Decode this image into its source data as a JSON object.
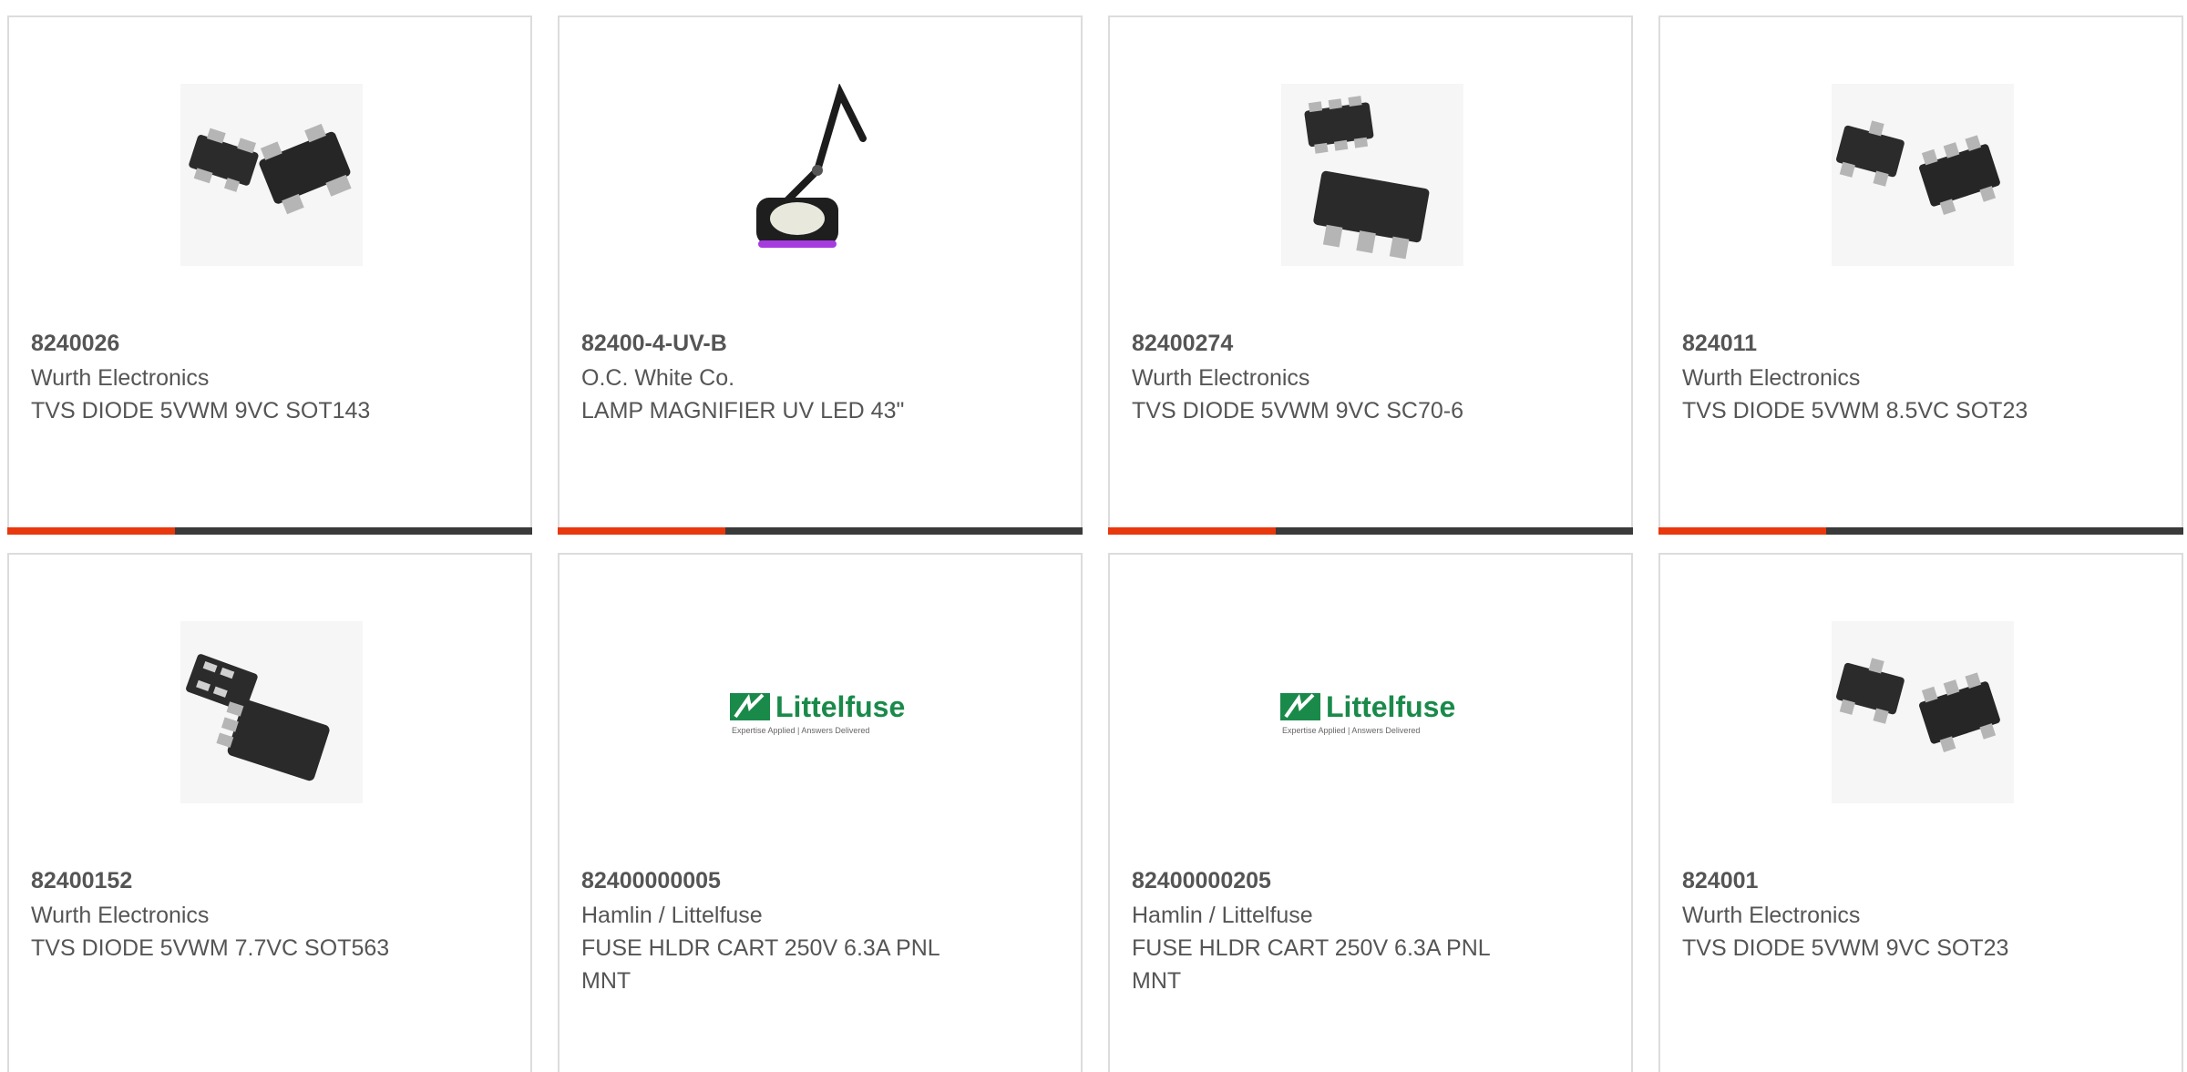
{
  "colors": {
    "border": "#dcdcdc",
    "text": "#555555",
    "bar_dark": "#3a3a3a",
    "bar_accent": "#e8380d",
    "littelfuse_green": "#1a8a4a"
  },
  "products": [
    {
      "part_number": "8240026",
      "manufacturer": "Wurth Electronics",
      "description": "TVS DIODE 5VWM 9VC SOT143",
      "image_icon": "sot143-chip-icon"
    },
    {
      "part_number": "82400-4-UV-B",
      "manufacturer": "O.C. White Co.",
      "description": "LAMP MAGNIFIER UV LED 43\"",
      "image_icon": "magnifier-lamp-icon"
    },
    {
      "part_number": "82400274",
      "manufacturer": "Wurth Electronics",
      "description": "TVS DIODE 5VWM 9VC SC70-6",
      "image_icon": "sc70-chip-icon"
    },
    {
      "part_number": "824011",
      "manufacturer": "Wurth Electronics",
      "description": "TVS DIODE 5VWM 8.5VC SOT23",
      "image_icon": "sot23-chip-icon"
    },
    {
      "part_number": "82400152",
      "manufacturer": "Wurth Electronics",
      "description": "TVS DIODE 5VWM 7.7VC SOT563",
      "image_icon": "sot563-chip-icon"
    },
    {
      "part_number": "82400000005",
      "manufacturer": "Hamlin / Littelfuse",
      "description": "FUSE HLDR CART 250V 6.3A PNL MNT",
      "image_icon": "littelfuse-logo-icon",
      "logo_text": "Littelfuse",
      "logo_tagline": "Expertise Applied | Answers Delivered"
    },
    {
      "part_number": "82400000205",
      "manufacturer": "Hamlin / Littelfuse",
      "description": "FUSE HLDR CART 250V 6.3A PNL MNT",
      "image_icon": "littelfuse-logo-icon",
      "logo_text": "Littelfuse",
      "logo_tagline": "Expertise Applied | Answers Delivered"
    },
    {
      "part_number": "824001",
      "manufacturer": "Wurth Electronics",
      "description": "TVS DIODE 5VWM 9VC SOT23",
      "image_icon": "sot23-chip-icon"
    }
  ]
}
